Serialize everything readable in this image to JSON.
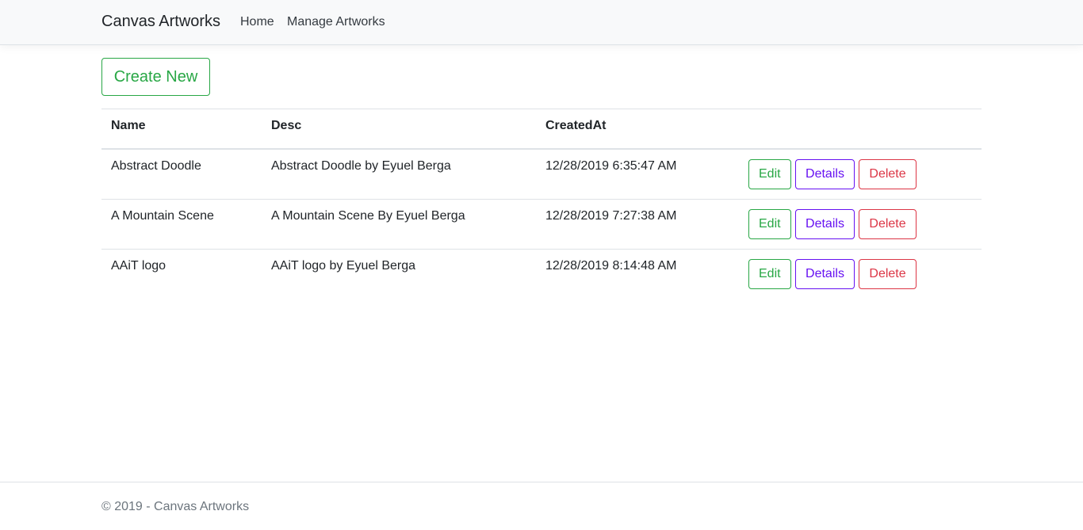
{
  "navbar": {
    "brand": "Canvas Artworks",
    "links": [
      {
        "label": "Home"
      },
      {
        "label": "Manage Artworks"
      }
    ]
  },
  "main": {
    "create_label": "Create New",
    "table": {
      "headers": [
        "Name",
        "Desc",
        "CreatedAt",
        ""
      ],
      "rows": [
        {
          "name": "Abstract Doodle",
          "desc": "Abstract Doodle by Eyuel Berga",
          "created_at": "12/28/2019 6:35:47 AM"
        },
        {
          "name": "A Mountain Scene",
          "desc": "A Mountain Scene By Eyuel Berga",
          "created_at": "12/28/2019 7:27:38 AM"
        },
        {
          "name": "AAiT logo",
          "desc": "AAiT logo by Eyuel Berga",
          "created_at": "12/28/2019 8:14:48 AM"
        }
      ],
      "actions": {
        "edit": "Edit",
        "details": "Details",
        "delete": "Delete"
      }
    }
  },
  "footer": {
    "prefix": "© 2019 - ",
    "link": "Canvas Artworks"
  },
  "colors": {
    "success": "#28a745",
    "indigo": "#6610f2",
    "danger": "#dc3545",
    "navbar_bg": "#f8f9fa",
    "muted": "#6c757d"
  }
}
